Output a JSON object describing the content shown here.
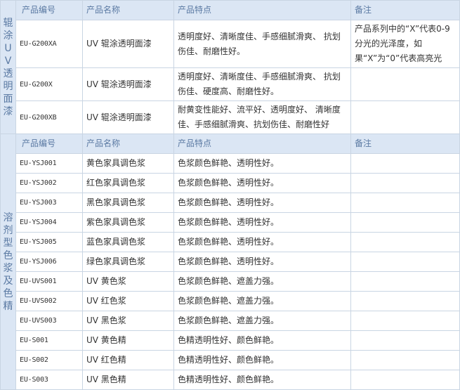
{
  "headers": {
    "code": "产品编号",
    "name": "产品名称",
    "features": "产品特点",
    "notes": "备注"
  },
  "sections": [
    {
      "category": "辊涂UV透明面漆",
      "rows": [
        {
          "code": "EU-G200XA",
          "name": "UV 辊涂透明面漆",
          "features": "透明度好、清晰度佳、手感细腻滑爽、 抗划伤佳、耐磨性好。",
          "notes": "产品系列中的“X”代表0-9分光的光泽度，如果“X”为“0”代表高亮光"
        },
        {
          "code": "EU-G200X",
          "name": "UV 辊涂透明面漆",
          "features": "透明度好、清晰度佳、手感细腻滑爽、 抗划伤佳、硬度高、耐磨性好。",
          "notes": ""
        },
        {
          "code": "EU-G200XB",
          "name": "UV 辊涂透明面漆",
          "features": "耐黄变性能好、流平好、透明度好、 清晰度佳、手感细腻滑爽、抗划伤佳、耐磨性好",
          "notes": ""
        }
      ]
    },
    {
      "category": "溶剂型色浆及色精",
      "rows": [
        {
          "code": "EU-YSJ001",
          "name": "黄色家具调色浆",
          "features": "色浆颜色鲜艳、透明性好。",
          "notes": ""
        },
        {
          "code": "EU-YSJ002",
          "name": "红色家具调色浆",
          "features": "色浆颜色鲜艳、透明性好。",
          "notes": ""
        },
        {
          "code": "EU-YSJ003",
          "name": "黑色家具调色浆",
          "features": "色浆颜色鲜艳、透明性好。",
          "notes": ""
        },
        {
          "code": "EU-YSJ004",
          "name": "紫色家具调色浆",
          "features": "色浆颜色鲜艳、透明性好。",
          "notes": ""
        },
        {
          "code": "EU-YSJ005",
          "name": "蓝色家具调色浆",
          "features": "色浆颜色鲜艳、透明性好。",
          "notes": ""
        },
        {
          "code": "EU-YSJ006",
          "name": "绿色家具调色浆",
          "features": "色浆颜色鲜艳、透明性好。",
          "notes": ""
        },
        {
          "code": "EU-UVS001",
          "name": "UV 黄色浆",
          "features": "色浆颜色鲜艳、遮盖力强。",
          "notes": ""
        },
        {
          "code": "EU-UVS002",
          "name": "UV 红色浆",
          "features": "色浆颜色鲜艳、遮盖力强。",
          "notes": ""
        },
        {
          "code": "EU-UVS003",
          "name": "UV 黑色浆",
          "features": "色浆颜色鲜艳、遮盖力强。",
          "notes": ""
        },
        {
          "code": "EU-S001",
          "name": "UV 黄色精",
          "features": "色精透明性好、颜色鲜艳。",
          "notes": ""
        },
        {
          "code": "EU-S002",
          "name": "UV 红色精",
          "features": "色精透明性好、颜色鲜艳。",
          "notes": ""
        },
        {
          "code": "EU-S003",
          "name": "UV 黑色精",
          "features": "色精透明性好、颜色鲜艳。",
          "notes": ""
        }
      ]
    }
  ],
  "colors": {
    "header_bg": "#dbe6f4",
    "header_text": "#5b7aa3",
    "border": "#c9d5e3",
    "body_text": "#333333"
  }
}
